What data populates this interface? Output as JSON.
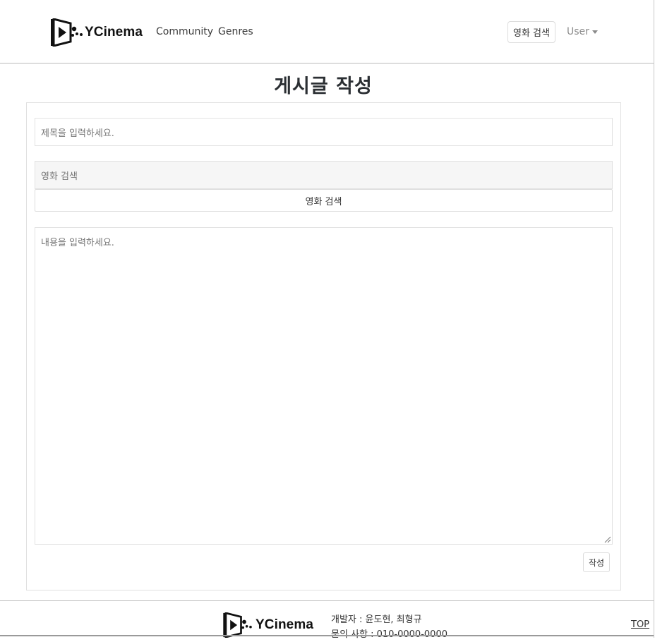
{
  "navbar": {
    "brand": "YCinema",
    "links": [
      "Community",
      "Genres"
    ],
    "search_button": "영화 검색",
    "user_menu": "User"
  },
  "page": {
    "title": "게시글 작성"
  },
  "form": {
    "title_placeholder": "제목을 입력하세요.",
    "movie_placeholder": "영화 검색",
    "movie_search_button": "영화 검색",
    "content_placeholder": "내용을 입력하세요.",
    "submit_button": "작성"
  },
  "footer": {
    "brand": "YCinema",
    "developers": "개발자 : 윤도현, 최형규",
    "contact": "문의 사항 : 010-0000-0000",
    "top_link": "TOP"
  },
  "colors": {
    "text": "#212529",
    "border": "#e2e2e2",
    "muted": "#8a8a8a"
  }
}
